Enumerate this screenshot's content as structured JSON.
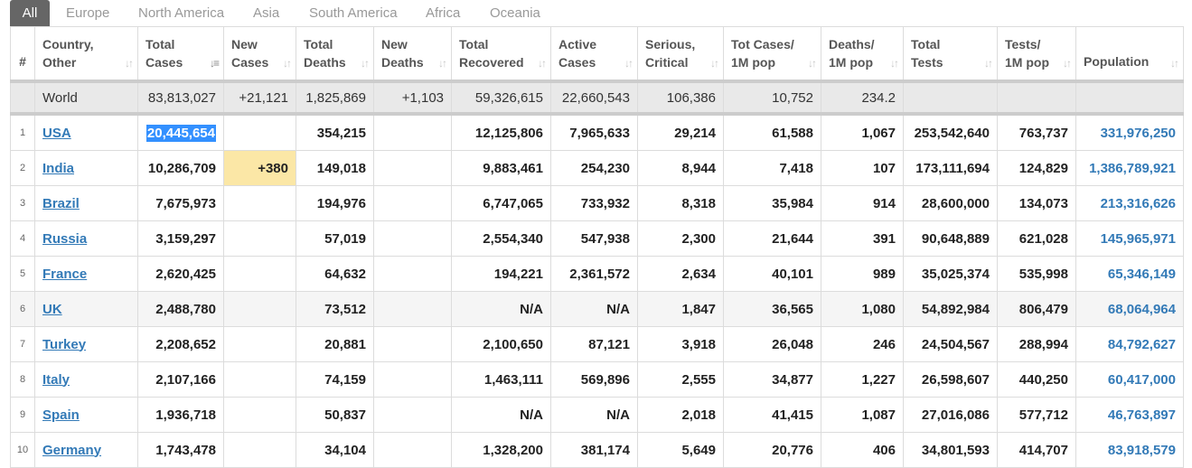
{
  "tabs": [
    "All",
    "Europe",
    "North America",
    "Asia",
    "South America",
    "Africa",
    "Oceania"
  ],
  "active_tab": "All",
  "columns": [
    {
      "l1": "#",
      "l2": ""
    },
    {
      "l1": "Country,",
      "l2": "Other"
    },
    {
      "l1": "Total",
      "l2": "Cases"
    },
    {
      "l1": "New",
      "l2": "Cases"
    },
    {
      "l1": "Total",
      "l2": "Deaths"
    },
    {
      "l1": "New",
      "l2": "Deaths"
    },
    {
      "l1": "Total",
      "l2": "Recovered"
    },
    {
      "l1": "Active",
      "l2": "Cases"
    },
    {
      "l1": "Serious,",
      "l2": "Critical"
    },
    {
      "l1": "Tot Cases/",
      "l2": "1M pop"
    },
    {
      "l1": "Deaths/",
      "l2": "1M pop"
    },
    {
      "l1": "Total",
      "l2": "Tests"
    },
    {
      "l1": "Tests/",
      "l2": "1M pop"
    },
    {
      "l1": "Population",
      "l2": ""
    }
  ],
  "world": [
    "",
    "World",
    "83,813,027",
    "+21,121",
    "1,825,869",
    "+1,103",
    "59,326,615",
    "22,660,543",
    "106,386",
    "10,752",
    "234.2",
    "",
    "",
    ""
  ],
  "rows": [
    [
      "1",
      "USA",
      "20,445,654",
      "",
      "354,215",
      "",
      "12,125,806",
      "7,965,633",
      "29,214",
      "61,588",
      "1,067",
      "253,542,640",
      "763,737",
      "331,976,250"
    ],
    [
      "2",
      "India",
      "10,286,709",
      "+380",
      "149,018",
      "",
      "9,883,461",
      "254,230",
      "8,944",
      "7,418",
      "107",
      "173,111,694",
      "124,829",
      "1,386,789,921"
    ],
    [
      "3",
      "Brazil",
      "7,675,973",
      "",
      "194,976",
      "",
      "6,747,065",
      "733,932",
      "8,318",
      "35,984",
      "914",
      "28,600,000",
      "134,073",
      "213,316,626"
    ],
    [
      "4",
      "Russia",
      "3,159,297",
      "",
      "57,019",
      "",
      "2,554,340",
      "547,938",
      "2,300",
      "21,644",
      "391",
      "90,648,889",
      "621,028",
      "145,965,971"
    ],
    [
      "5",
      "France",
      "2,620,425",
      "",
      "64,632",
      "",
      "194,221",
      "2,361,572",
      "2,634",
      "40,101",
      "989",
      "35,025,374",
      "535,998",
      "65,346,149"
    ],
    [
      "6",
      "UK",
      "2,488,780",
      "",
      "73,512",
      "",
      "N/A",
      "N/A",
      "1,847",
      "36,565",
      "1,080",
      "54,892,984",
      "806,479",
      "68,064,964"
    ],
    [
      "7",
      "Turkey",
      "2,208,652",
      "",
      "20,881",
      "",
      "2,100,650",
      "87,121",
      "3,918",
      "26,048",
      "246",
      "24,504,567",
      "288,994",
      "84,792,627"
    ],
    [
      "8",
      "Italy",
      "2,107,166",
      "",
      "74,159",
      "",
      "1,463,111",
      "569,896",
      "2,555",
      "34,877",
      "1,227",
      "26,598,607",
      "440,250",
      "60,417,000"
    ],
    [
      "9",
      "Spain",
      "1,936,718",
      "",
      "50,837",
      "",
      "N/A",
      "N/A",
      "2,018",
      "41,415",
      "1,087",
      "27,016,086",
      "577,712",
      "46,763,897"
    ],
    [
      "10",
      "Germany",
      "1,743,478",
      "",
      "34,104",
      "",
      "1,328,200",
      "381,174",
      "5,649",
      "20,776",
      "406",
      "34,801,593",
      "414,707",
      "83,918,579"
    ]
  ],
  "colors": {
    "link": "#337ab7",
    "new_cases_highlight": "#fbe7a6",
    "selection": "#3390ff",
    "world_bg": "#e9e9e9",
    "tab_active": "#666666"
  }
}
